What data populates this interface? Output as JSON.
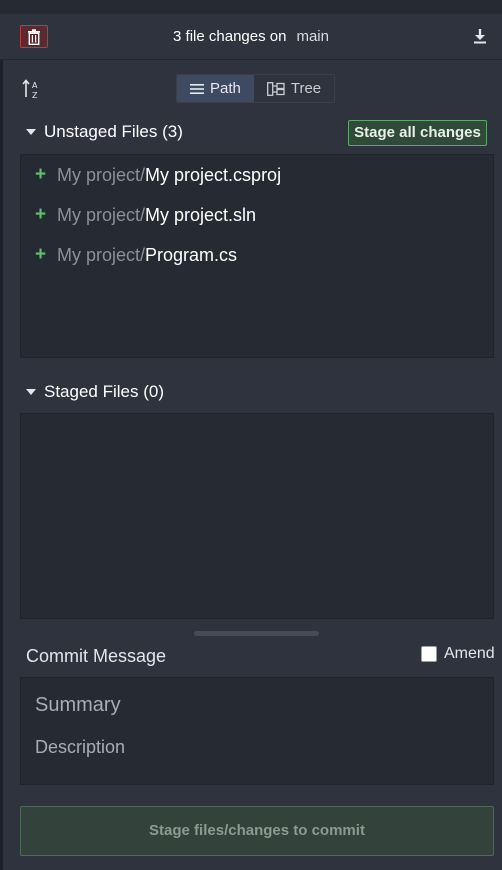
{
  "header": {
    "title": "3 file changes on",
    "branch": "main"
  },
  "view_toggle": {
    "path_label": "Path",
    "tree_label": "Tree",
    "selected": "Path"
  },
  "unstaged": {
    "title": "Unstaged Files (3)",
    "stage_all_label": "Stage all changes",
    "files": [
      {
        "dir": "My project/",
        "name": "My project.csproj"
      },
      {
        "dir": "My project/",
        "name": "My project.sln"
      },
      {
        "dir": "My project/",
        "name": "Program.cs"
      }
    ]
  },
  "staged": {
    "title": "Staged Files (0)",
    "files": []
  },
  "commit": {
    "label": "Commit Message",
    "amend_label": "Amend",
    "amend_checked": false,
    "summary_placeholder": "Summary",
    "description_placeholder": "Description",
    "button_label": "Stage files/changes to commit"
  },
  "colors": {
    "accent_green": "#5cc46a",
    "discard_red": "#c03a3a",
    "active_segment": "#3d4a62"
  },
  "icons": {
    "discard": "trash-icon",
    "download": "download-icon",
    "sort": "sort-az-icon",
    "path": "list-icon",
    "tree": "tree-icon",
    "add": "plus-icon"
  }
}
